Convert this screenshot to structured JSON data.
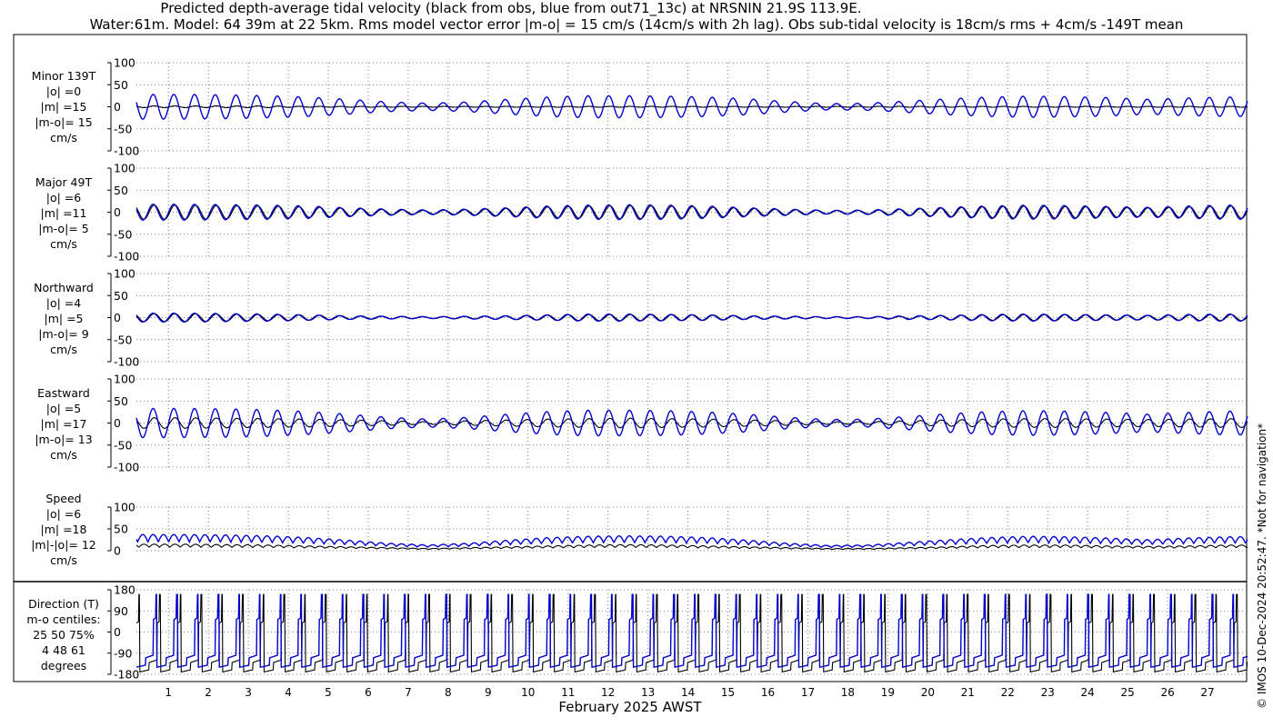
{
  "title_line1": "Predicted depth-average tidal velocity (black from obs, blue from out71_13c) at NRSNIN 21.9S 113.9E.",
  "title_line2": "Water:61m. Model: 64 39m at 22 5km. Rms model vector error |m-o| = 15 cm/s (14cm/s with 2h lag). Obs sub-tidal velocity is 18cm/s rms + 4cm/s -149T mean",
  "xlabel": "February 2025 AWST",
  "copyright": "© IMOS 10-Dec-2024 20:52:47. *Not for navigation*",
  "colors": {
    "obs": "#000000",
    "model": "#0000cc",
    "grid": "#555555"
  },
  "chart_data": [
    {
      "type": "line",
      "id": "minor",
      "panel_labels": [
        "Minor 139T",
        "|o| =0",
        "|m| =15",
        "|m-o|= 15",
        "cm/s"
      ],
      "ylim": [
        -100,
        100
      ],
      "yticks": [
        100,
        50,
        0,
        -50,
        -100
      ],
      "xlim": [
        0.2,
        28.0
      ],
      "xticks": [
        1,
        2,
        3,
        4,
        5,
        6,
        7,
        8,
        9,
        10,
        11,
        12,
        13,
        14,
        15,
        16,
        17,
        18,
        19,
        20,
        21,
        22,
        23,
        24,
        25,
        26,
        27
      ],
      "series": [
        {
          "color": "black",
          "amplitude_profile_cm_s": [
            2,
            2,
            2,
            2,
            1,
            1,
            1,
            1,
            1,
            1,
            1,
            1,
            1,
            1,
            1,
            1,
            1,
            1,
            1,
            1,
            1,
            1,
            1,
            1,
            1,
            1,
            1,
            1
          ]
        },
        {
          "color": "blue",
          "amplitude_profile_cm_s": [
            28,
            28,
            27,
            25,
            22,
            17,
            11,
            8,
            11,
            17,
            22,
            25,
            25,
            24,
            22,
            18,
            12,
            7,
            8,
            13,
            18,
            22,
            24,
            23,
            21,
            17,
            20,
            22
          ]
        }
      ]
    },
    {
      "type": "line",
      "id": "major",
      "panel_labels": [
        "Major 49T",
        "|o| =6",
        "|m| =11",
        "|m-o|= 5",
        "cm/s"
      ],
      "ylim": [
        -100,
        100
      ],
      "yticks": [
        100,
        50,
        0,
        -50,
        -100
      ],
      "xlim": [
        0.2,
        28.0
      ],
      "xticks": [
        1,
        2,
        3,
        4,
        5,
        6,
        7,
        8,
        9,
        10,
        11,
        12,
        13,
        14,
        15,
        16,
        17,
        18,
        19,
        20,
        21,
        22,
        23,
        24,
        25,
        26,
        27
      ],
      "series": [
        {
          "color": "black",
          "amplitude_profile_cm_s": [
            16,
            16,
            15,
            14,
            12,
            9,
            6,
            4,
            6,
            9,
            12,
            14,
            15,
            14,
            12,
            9,
            6,
            4,
            4,
            7,
            10,
            13,
            14,
            13,
            12,
            10,
            12,
            14
          ]
        },
        {
          "color": "blue",
          "amplitude_profile_cm_s": [
            18,
            18,
            17,
            16,
            14,
            10,
            7,
            5,
            7,
            10,
            14,
            16,
            17,
            16,
            14,
            10,
            7,
            4,
            5,
            8,
            11,
            14,
            16,
            15,
            13,
            11,
            14,
            16
          ]
        }
      ]
    },
    {
      "type": "line",
      "id": "northward",
      "panel_labels": [
        "Northward",
        "|o| =4",
        "|m| =5",
        "|m-o|= 9",
        "cm/s"
      ],
      "ylim": [
        -100,
        100
      ],
      "yticks": [
        100,
        50,
        0,
        -50,
        -100
      ],
      "xlim": [
        0.2,
        28.0
      ],
      "xticks": [
        1,
        2,
        3,
        4,
        5,
        6,
        7,
        8,
        9,
        10,
        11,
        12,
        13,
        14,
        15,
        16,
        17,
        18,
        19,
        20,
        21,
        22,
        23,
        24,
        25,
        26,
        27
      ],
      "series": [
        {
          "color": "black",
          "amplitude_profile_cm_s": [
            9,
            9,
            8,
            7,
            6,
            4,
            3,
            2,
            3,
            4,
            6,
            7,
            7,
            7,
            6,
            4,
            3,
            2,
            2,
            3,
            5,
            6,
            7,
            7,
            6,
            5,
            6,
            7
          ]
        },
        {
          "color": "blue",
          "amplitude_profile_cm_s": [
            10,
            10,
            9,
            8,
            6,
            4,
            3,
            2,
            3,
            4,
            6,
            8,
            8,
            7,
            6,
            4,
            3,
            2,
            2,
            4,
            5,
            7,
            8,
            7,
            6,
            5,
            7,
            8
          ]
        }
      ]
    },
    {
      "type": "line",
      "id": "eastward",
      "panel_labels": [
        "Eastward",
        "|o| =5",
        "|m| =17",
        "|m-o|= 13",
        "cm/s"
      ],
      "ylim": [
        -100,
        100
      ],
      "yticks": [
        100,
        50,
        0,
        -50,
        -100
      ],
      "xlim": [
        0.2,
        28.0
      ],
      "xticks": [
        1,
        2,
        3,
        4,
        5,
        6,
        7,
        8,
        9,
        10,
        11,
        12,
        13,
        14,
        15,
        16,
        17,
        18,
        19,
        20,
        21,
        22,
        23,
        24,
        25,
        26,
        27
      ],
      "series": [
        {
          "color": "black",
          "amplitude_profile_cm_s": [
            12,
            12,
            11,
            10,
            9,
            7,
            5,
            3,
            5,
            7,
            9,
            10,
            11,
            10,
            9,
            7,
            5,
            3,
            3,
            5,
            7,
            9,
            10,
            10,
            9,
            8,
            9,
            10
          ]
        },
        {
          "color": "blue",
          "amplitude_profile_cm_s": [
            33,
            33,
            32,
            30,
            26,
            20,
            13,
            9,
            13,
            20,
            26,
            29,
            29,
            28,
            25,
            20,
            13,
            8,
            9,
            15,
            21,
            26,
            28,
            27,
            24,
            20,
            24,
            27
          ]
        }
      ]
    },
    {
      "type": "line",
      "id": "speed",
      "panel_labels": [
        "Speed",
        "|o| =6",
        "|m| =18",
        "|m|-|o|= 12",
        "cm/s"
      ],
      "ylim": [
        0,
        100
      ],
      "yticks": [
        100,
        50,
        0
      ],
      "xlim": [
        0.2,
        28.0
      ],
      "xticks": [
        1,
        2,
        3,
        4,
        5,
        6,
        7,
        8,
        9,
        10,
        11,
        12,
        13,
        14,
        15,
        16,
        17,
        18,
        19,
        20,
        21,
        22,
        23,
        24,
        25,
        26,
        27
      ],
      "series": [
        {
          "color": "black",
          "amplitude_profile_cm_s": [
            14,
            14,
            13,
            12,
            10,
            8,
            6,
            4,
            6,
            8,
            10,
            12,
            13,
            12,
            10,
            8,
            6,
            4,
            4,
            6,
            8,
            11,
            12,
            12,
            10,
            9,
            10,
            12
          ]
        },
        {
          "color": "blue",
          "amplitude_profile_cm_s": [
            34,
            34,
            33,
            31,
            27,
            21,
            14,
            10,
            14,
            21,
            27,
            30,
            31,
            30,
            27,
            21,
            14,
            9,
            10,
            16,
            22,
            27,
            30,
            29,
            26,
            22,
            26,
            29
          ]
        }
      ]
    },
    {
      "type": "line",
      "id": "direction",
      "panel_labels": [
        "Direction (T)",
        "m-o centiles:",
        "25  50  75%",
        "4  48  61",
        "degrees"
      ],
      "ylim": [
        -180,
        180
      ],
      "yticks": [
        180,
        90,
        0,
        -90,
        -180
      ],
      "xlim": [
        0.2,
        28.0
      ],
      "xticks": [
        1,
        2,
        3,
        4,
        5,
        6,
        7,
        8,
        9,
        10,
        11,
        12,
        13,
        14,
        15,
        16,
        17,
        18,
        19,
        20,
        21,
        22,
        23,
        24,
        25,
        26,
        27
      ],
      "series": [
        {
          "color": "black",
          "waveform": "step",
          "levels_deg": [
            -130,
            45,
            160
          ]
        },
        {
          "color": "blue",
          "waveform": "step",
          "levels_deg": [
            -110,
            60,
            160
          ]
        }
      ]
    }
  ]
}
